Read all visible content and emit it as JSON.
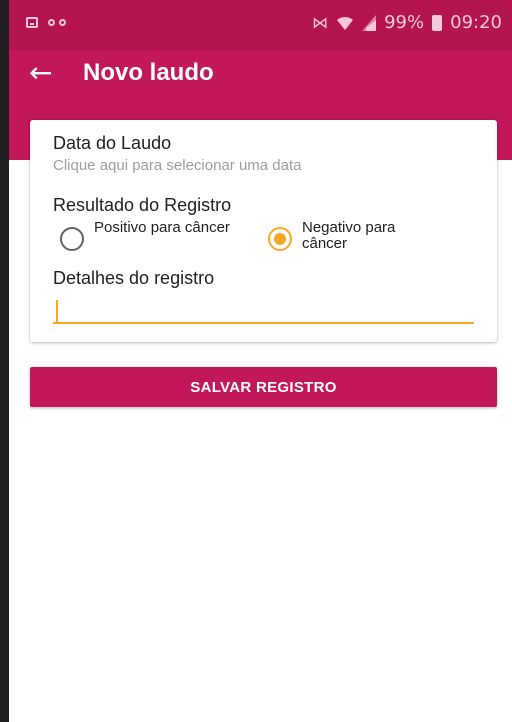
{
  "status_bar": {
    "icons": [
      "image-notification-icon",
      "voicemail-icon",
      "mute-icon",
      "wifi-icon",
      "signal-icon",
      "battery-charging-icon"
    ],
    "battery": "99%",
    "time": "09:20"
  },
  "app_bar": {
    "back_icon": "arrow-back-icon",
    "title": "Novo laudo"
  },
  "form": {
    "date_label": "Data do Laudo",
    "date_placeholder": "Clique aqui para selecionar uma data",
    "result_label": "Resultado do Registro",
    "options": [
      {
        "label": "Positivo para câncer",
        "selected": false
      },
      {
        "label": "Negativo para câncer",
        "selected": true
      }
    ],
    "details_label": "Detalhes do registro",
    "details_value": ""
  },
  "save_button": "SALVAR REGISTRO",
  "colors": {
    "primary": "#c2185b",
    "status_bar": "#b4154f",
    "accent": "#f9a825"
  }
}
